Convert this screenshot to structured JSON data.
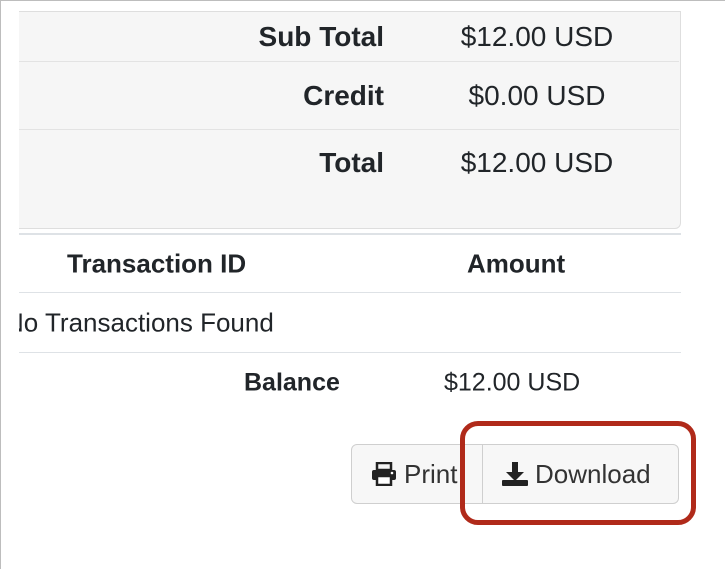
{
  "totals": {
    "rows": [
      {
        "label": "Sub Total",
        "value": "$12.00 USD"
      },
      {
        "label": "Credit",
        "value": "$0.00 USD"
      },
      {
        "label": "Total",
        "value": "$12.00 USD"
      }
    ]
  },
  "transactions": {
    "headers": {
      "transaction_id": "Transaction ID",
      "amount": "Amount"
    },
    "empty_message": "No Transactions Found"
  },
  "balance": {
    "label": "Balance",
    "value": "$12.00 USD"
  },
  "actions": {
    "print_label": "Print",
    "print_icon": "printer-icon",
    "download_label": "Download",
    "download_icon": "download-icon",
    "highlight_color": "#b02a1a"
  }
}
